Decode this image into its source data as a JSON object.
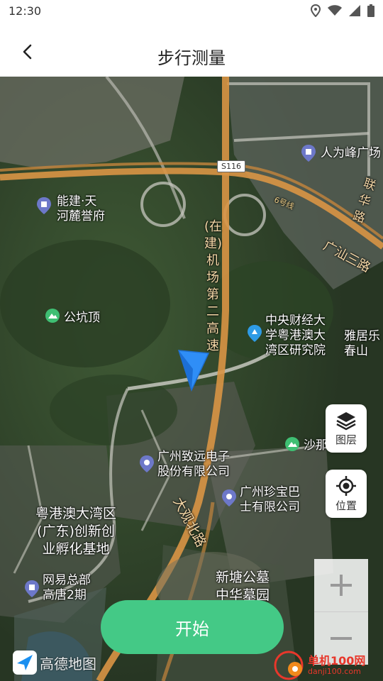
{
  "status_bar": {
    "time": "12:30"
  },
  "header": {
    "title": "步行测量"
  },
  "map": {
    "labels": {
      "renweifeng": "人为峰广场",
      "road_s116": "S116",
      "lianhua": "联华路",
      "line6": "6号线",
      "guangshan": "广汕三路",
      "nengjian_1": "能建·天",
      "nengjian_2": "河麓誉府",
      "gongkengding": "公坑顶",
      "airport_road": "(在建)机场第二高速",
      "cufe_1": "中央财经大",
      "cufe_2": "学粤港澳大",
      "cufe_3": "湾区研究院",
      "yaju_1": "雅居乐",
      "yaju_2": "春山",
      "shana": "沙那",
      "zhiyuan_1": "广州致远电子",
      "zhiyuan_2": "股份有限公司",
      "zhenbao_1": "广州珍宝巴",
      "zhenbao_2": "士有限公司",
      "dagu_north": "大观北路",
      "gba_1": "粤港澳大湾区",
      "gba_2": "(广东)创新创",
      "gba_3": "业孵化基地",
      "netease_1": "网易总部",
      "netease_2": "高唐2期",
      "xintang_1": "新塘公墓",
      "xintang_2": "中华墓园"
    }
  },
  "controls": {
    "layers_label": "图层",
    "location_label": "位置"
  },
  "start_button": {
    "label": "开始"
  },
  "logo": {
    "text": "高德地图"
  },
  "watermark": {
    "line1": "单机100网",
    "line2": "danji100.com"
  },
  "colors": {
    "accent": "#44c986",
    "pin": "#2f8ef7",
    "road_orange": "#d99545"
  },
  "icons": [
    "back-arrow-icon",
    "location-status-icon",
    "wifi-icon",
    "signal-icon",
    "battery-icon",
    "layers-icon",
    "locate-icon",
    "zoom-in-icon",
    "zoom-out-icon",
    "navigation-arrow-icon"
  ]
}
